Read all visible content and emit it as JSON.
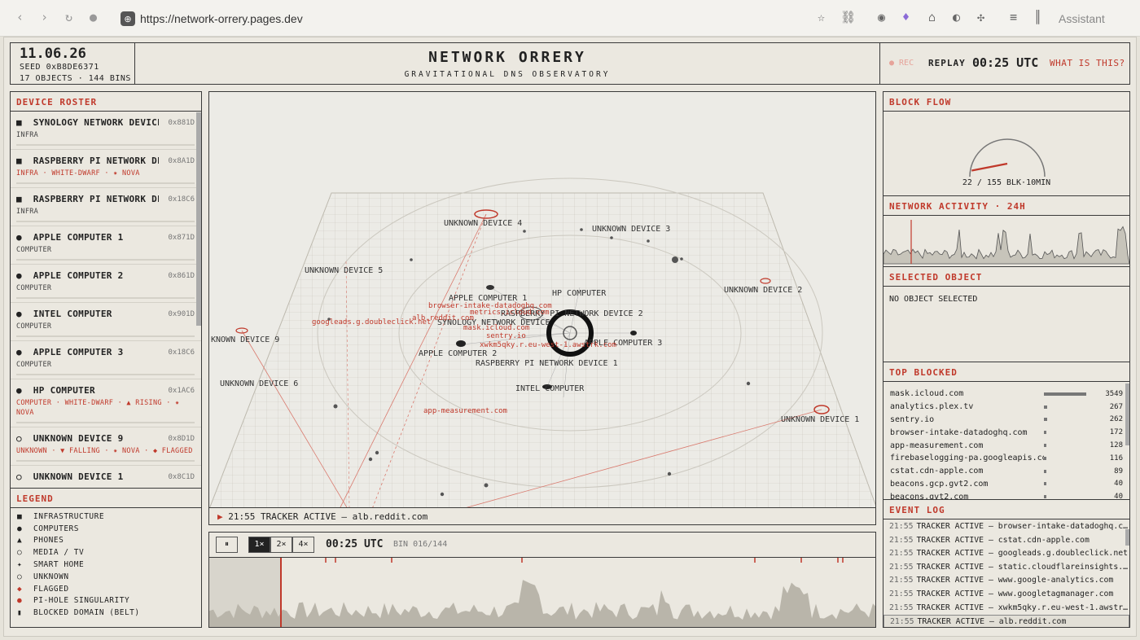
{
  "browser": {
    "url": "https://network-orrery.pages.dev",
    "assistant": "Assistant"
  },
  "header": {
    "date": "11.06.26",
    "seed": "SEED 0xB8DE6371",
    "counts": "17 OBJECTS · 144 BINS",
    "title": "NETWORK ORRERY",
    "subtitle": "GRAVITATIONAL DNS OBSERVATORY",
    "rec": "● REC",
    "replay": "REPLAY",
    "time": "00:25 UTC",
    "help": "WHAT IS THIS?"
  },
  "roster": {
    "title": "DEVICE ROSTER",
    "devices": [
      {
        "glyph": "■",
        "name": "SYNOLOGY NETWORK DEVICE",
        "id": "0x881D",
        "tags": "INFRA",
        "red": false
      },
      {
        "glyph": "■",
        "name": "RASPBERRY PI NETWORK DEV…",
        "id": "0x8A1D",
        "tags": "INFRA · WHITE-DWARF · ✷ NOVA",
        "red": true
      },
      {
        "glyph": "■",
        "name": "RASPBERRY PI NETWORK DEV…",
        "id": "0x18C6",
        "tags": "INFRA",
        "red": false
      },
      {
        "glyph": "●",
        "name": "APPLE COMPUTER 1",
        "id": "0x871D",
        "tags": "COMPUTER",
        "red": false
      },
      {
        "glyph": "●",
        "name": "APPLE COMPUTER 2",
        "id": "0x861D",
        "tags": "COMPUTER",
        "red": false
      },
      {
        "glyph": "●",
        "name": "INTEL COMPUTER",
        "id": "0x901D",
        "tags": "COMPUTER",
        "red": false
      },
      {
        "glyph": "●",
        "name": "APPLE COMPUTER 3",
        "id": "0x18C6",
        "tags": "COMPUTER",
        "red": false
      },
      {
        "glyph": "●",
        "name": "HP COMPUTER",
        "id": "0x1AC6",
        "tags": "COMPUTER · WHITE-DWARF · ▲ RISING · ✷",
        "tags2": "NOVA",
        "red": true
      },
      {
        "glyph": "○",
        "name": "UNKNOWN DEVICE 9",
        "id": "0x8D1D",
        "tags": "UNKNOWN · ▼ FALLING · ✷ NOVA · ◆ FLAGGED",
        "red": true
      },
      {
        "glyph": "○",
        "name": "UNKNOWN DEVICE 1",
        "id": "0x8C1D",
        "tags": "",
        "red": true
      }
    ]
  },
  "legend": {
    "title": "LEGEND",
    "items": [
      {
        "glyph": "■",
        "label": "INFRASTRUCTURE",
        "red": false
      },
      {
        "glyph": "●",
        "label": "COMPUTERS",
        "red": false
      },
      {
        "glyph": "▲",
        "label": "PHONES",
        "red": false
      },
      {
        "glyph": "○",
        "label": "MEDIA / TV",
        "red": false
      },
      {
        "glyph": "✦",
        "label": "SMART HOME",
        "red": false
      },
      {
        "glyph": "○",
        "label": "UNKNOWN",
        "red": false
      },
      {
        "glyph": "◆",
        "label": "FLAGGED",
        "red": true
      },
      {
        "glyph": "●",
        "label": "PI-HOLE SINGULARITY",
        "red": true
      },
      {
        "glyph": "▮",
        "label": "BLOCKED DOMAIN (BELT)",
        "red": false
      }
    ]
  },
  "scene": {
    "labels": [
      "UNKNOWN DEVICE 4",
      "UNKNOWN DEVICE 3",
      "UNKNOWN DEVICE 5",
      "UNKNOWN DEVICE 2",
      "APPLE COMPUTER 1",
      "HP COMPUTER",
      "RASPBERRY PI NETWORK DEVICE 2",
      "SYNOLOGY NETWORK DEVICE",
      "APPLE COMPUTER 3",
      "APPLE COMPUTER 2",
      "RASPBERRY PI NETWORK DEVICE 1",
      "KNOWN DEVICE 9",
      "UNKNOWN DEVICE 6",
      "INTEL COMPUTER",
      "UNKNOWN DEVICE 1"
    ],
    "domains": [
      "browser-intake-datadoghq.com",
      "metrics.icloud.com",
      "alb.reddit.com",
      "mask.icloud.com",
      "sentry.io",
      "xwkm5qky.r.eu-west-1.awstrk.com",
      "googleads.g.doubleclick.net",
      "app-measurement.com"
    ],
    "status": "21:55 TRACKER ACTIVE — alb.reddit.com"
  },
  "timeline": {
    "pause": "⏸",
    "speeds": [
      "1×",
      "2×",
      "4×"
    ],
    "time": "00:25 UTC",
    "bin": "BIN 016/144"
  },
  "block_flow": {
    "title": "BLOCK FLOW",
    "readout": "22 / 155 BLK·10MIN",
    "value": 22,
    "max": 155
  },
  "activity": {
    "title": "NETWORK ACTIVITY · 24H"
  },
  "selected": {
    "title": "SELECTED OBJECT",
    "text": "NO OBJECT SELECTED"
  },
  "top_blocked": {
    "title": "TOP BLOCKED",
    "rows": [
      {
        "domain": "mask.icloud.com",
        "count": "3549",
        "frac": 1.0
      },
      {
        "domain": "analytics.plex.tv",
        "count": "267",
        "frac": 0.075
      },
      {
        "domain": "sentry.io",
        "count": "262",
        "frac": 0.074
      },
      {
        "domain": "browser-intake-datadoghq.com",
        "count": "172",
        "frac": 0.048
      },
      {
        "domain": "app-measurement.com",
        "count": "128",
        "frac": 0.036
      },
      {
        "domain": "firebaselogging-pa.googleapis.com",
        "count": "116",
        "frac": 0.033
      },
      {
        "domain": "cstat.cdn-apple.com",
        "count": "89",
        "frac": 0.025
      },
      {
        "domain": "beacons.gcp.gvt2.com",
        "count": "40",
        "frac": 0.011
      },
      {
        "domain": "beacons.gvt2.com",
        "count": "40",
        "frac": 0.011
      }
    ]
  },
  "event_log": {
    "title": "EVENT LOG",
    "rows": [
      {
        "t": "21:55",
        "msg": "TRACKER ACTIVE — browser-intake-datadoghq.c…"
      },
      {
        "t": "21:55",
        "msg": "TRACKER ACTIVE — cstat.cdn-apple.com"
      },
      {
        "t": "21:55",
        "msg": "TRACKER ACTIVE — googleads.g.doubleclick.net"
      },
      {
        "t": "21:55",
        "msg": "TRACKER ACTIVE — static.cloudflareinsights.…"
      },
      {
        "t": "21:55",
        "msg": "TRACKER ACTIVE — www.google-analytics.com"
      },
      {
        "t": "21:55",
        "msg": "TRACKER ACTIVE — www.googletagmanager.com"
      },
      {
        "t": "21:55",
        "msg": "TRACKER ACTIVE — xwkm5qky.r.eu-west-1.awstr…"
      },
      {
        "t": "21:55",
        "msg": "TRACKER ACTIVE — alb.reddit.com"
      }
    ]
  }
}
